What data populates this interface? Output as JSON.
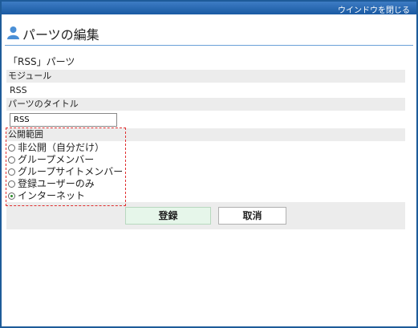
{
  "topbar": {
    "close_window_label": "ウインドウを閉じる"
  },
  "header": {
    "title": "パーツの編集",
    "icon": "person-icon"
  },
  "section": {
    "title": "「RSS」パーツ"
  },
  "form": {
    "module_label": "モジュール",
    "module_value": "RSS",
    "part_title_label": "パーツのタイトル",
    "part_title_value": "RSS",
    "visibility_label": "公開範囲",
    "visibility_options": [
      {
        "label": "非公開（自分だけ）",
        "selected": false
      },
      {
        "label": "グループメンバー",
        "selected": false
      },
      {
        "label": "グループサイトメンバー",
        "selected": false
      },
      {
        "label": "登録ユーザーのみ",
        "selected": false
      },
      {
        "label": "インターネット",
        "selected": true
      }
    ],
    "selected_visibility": "インターネット"
  },
  "buttons": {
    "register": "登録",
    "cancel": "取消"
  },
  "colors": {
    "topbar": "#1a5aa3",
    "highlight_border": "#e03030",
    "register_bg": "#e6f6ea"
  }
}
